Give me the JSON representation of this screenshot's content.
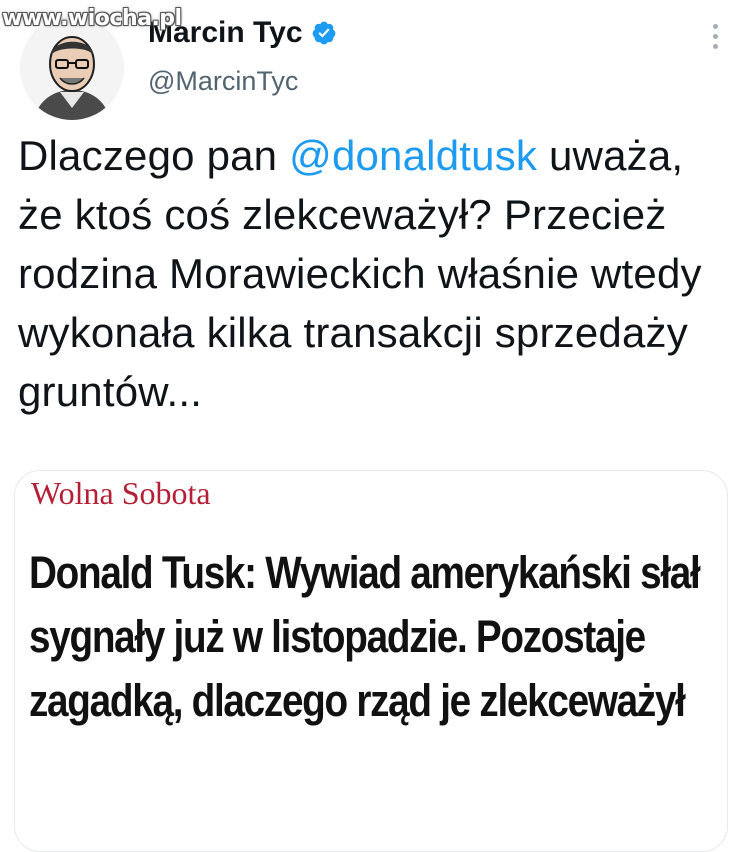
{
  "watermark": "www.wiocha.pl",
  "author": {
    "name": "Marcin Tyc",
    "handle": "@MarcinTyc",
    "verified": true
  },
  "tweet": {
    "text_before": "Dlaczego pan ",
    "mention": "@donaldtusk",
    "text_after": " uważa, że ktoś coś zlekceważył? Przecież rodzina Morawieckich właśnie wtedy wykonała kilka transakcji sprzedaży gruntów..."
  },
  "card": {
    "source": "Wolna Sobota",
    "headline": "Donald Tusk: Wywiad amerykański słał sygnały już w listopadzie. Pozostaje zagadką, dlaczego rząd je zlekceważył"
  },
  "icons": {
    "verified_badge": "verified-badge-icon",
    "more": "more-options-icon"
  },
  "colors": {
    "mention": "#1d9bf0",
    "verified": "#1d9bf0",
    "source": "#b41f36"
  }
}
